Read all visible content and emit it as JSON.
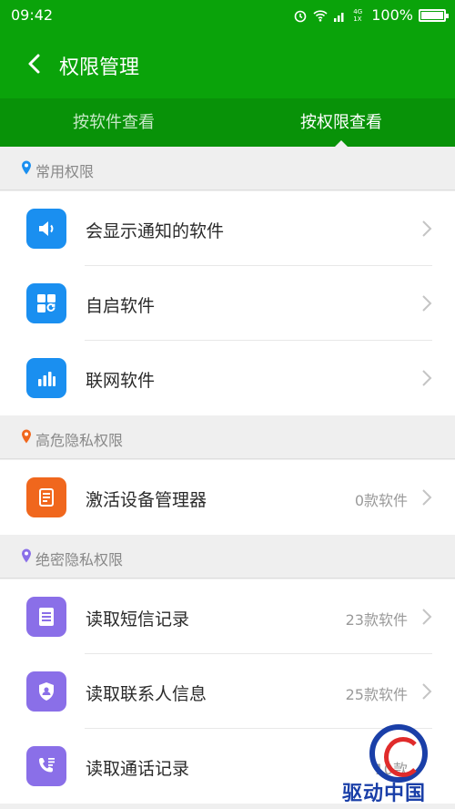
{
  "status": {
    "time": "09:42",
    "battery": "100%",
    "net": "4G 1X"
  },
  "appbar": {
    "title": "权限管理"
  },
  "tabs": [
    {
      "label": "按软件查看"
    },
    {
      "label": "按权限查看"
    }
  ],
  "sections": [
    {
      "label": "常用权限",
      "pin_color": "#1a8ff0"
    },
    {
      "label": "高危隐私权限",
      "pin_color": "#f0671d"
    },
    {
      "label": "绝密隐私权限",
      "pin_color": "#8a6fe8"
    }
  ],
  "rows": [
    {
      "label": "会显示通知的软件",
      "count": "",
      "icon": "speaker-icon"
    },
    {
      "label": "自启软件",
      "count": "",
      "icon": "autostart-icon"
    },
    {
      "label": "联网软件",
      "count": "",
      "icon": "bar-chart-icon"
    },
    {
      "label": "激活设备管理器",
      "count": "0款软件",
      "icon": "device-admin-icon"
    },
    {
      "label": "读取短信记录",
      "count": "23款软件",
      "icon": "document-icon"
    },
    {
      "label": "读取联系人信息",
      "count": "25款软件",
      "icon": "shield-user-icon"
    },
    {
      "label": "读取通话记录",
      "count": "10款",
      "icon": "phone-list-icon"
    }
  ],
  "watermark": {
    "text": "驱动中国"
  }
}
